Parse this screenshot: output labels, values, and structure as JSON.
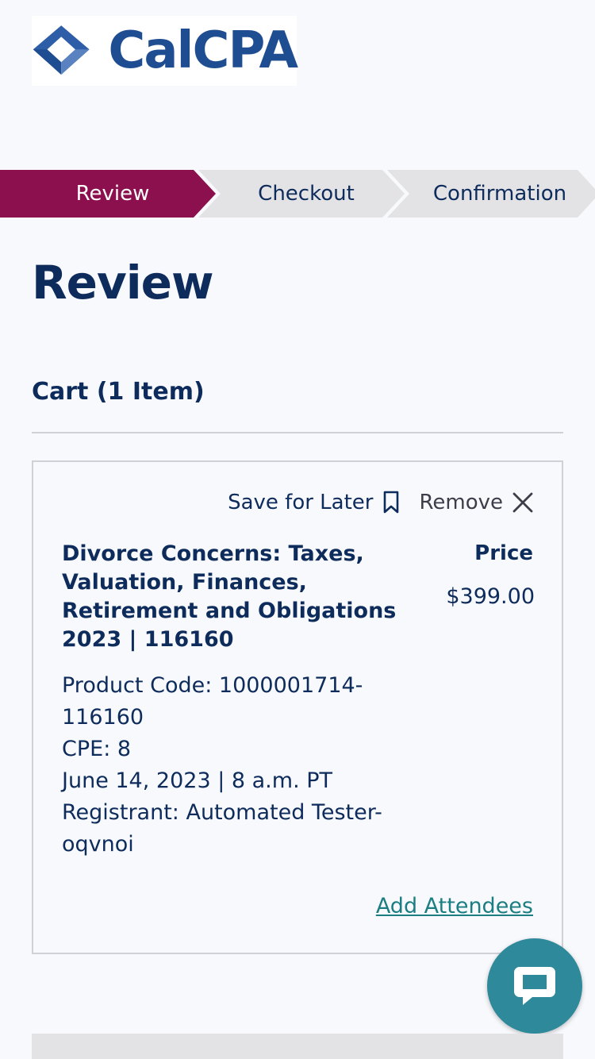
{
  "brand": {
    "name": "CalCPA",
    "color": "#1f4d92"
  },
  "steps": [
    {
      "label": "Review",
      "active": true
    },
    {
      "label": "Checkout",
      "active": false
    },
    {
      "label": "Confirmation",
      "active": false
    }
  ],
  "colors": {
    "active_step": "#8c0f4e",
    "inactive_step": "#e3e3e5",
    "link": "#1b7e82",
    "chat": "#2e8a9b"
  },
  "page": {
    "title": "Review"
  },
  "cart": {
    "heading": "Cart (1 Item)",
    "item": {
      "save_label": "Save for Later",
      "remove_label": "Remove",
      "title": "Divorce Concerns: Taxes, Valuation, Finances, Retirement and Obligations 2023 | 116160",
      "price_label": "Price",
      "price": "$399.00",
      "details": [
        "Product Code: 1000001714-116160",
        "CPE: 8",
        "June 14, 2023 | 8 a.m. PT",
        "Registrant: Automated Tester-oqvnoi"
      ],
      "add_attendees": "Add Attendees"
    }
  },
  "icons": {
    "save": "bookmark-icon",
    "remove": "close-icon",
    "chat": "chat-icon"
  }
}
